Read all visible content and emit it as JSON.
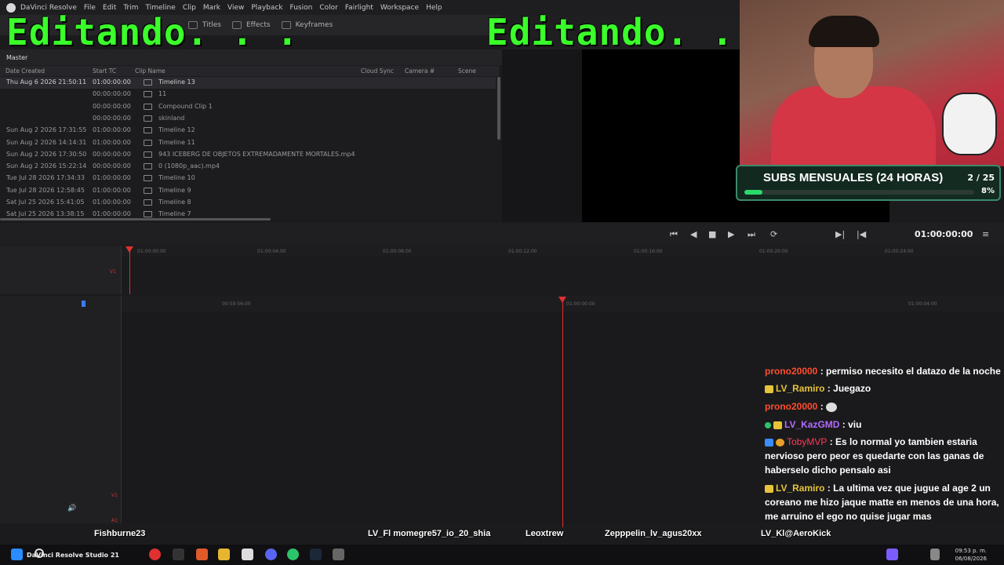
{
  "menubar": {
    "app": "DaVinci Resolve",
    "items": [
      "File",
      "Edit",
      "Trim",
      "Timeline",
      "Clip",
      "Mark",
      "View",
      "Playback",
      "Fusion",
      "Color",
      "Fairlight",
      "Workspace",
      "Help"
    ]
  },
  "toolbar": {
    "titles": "Titles",
    "effects": "Effects",
    "keyframes": "Keyframes"
  },
  "overlay": {
    "left_text": "Editando. . .",
    "right_text": "Editando. . ."
  },
  "mediapool": {
    "bin": "Master",
    "columns": [
      "Date Created",
      "Start TC",
      "Clip Name",
      "Cloud Sync",
      "Camera #",
      "Scene"
    ],
    "rows": [
      {
        "date": "Thu Aug 6 2026 21:50:11",
        "tc": "01:00:00:00",
        "name": "Timeline 13"
      },
      {
        "date": "",
        "tc": "00:00:00:00",
        "name": "11"
      },
      {
        "date": "",
        "tc": "00:00:00:00",
        "name": "Compound Clip 1"
      },
      {
        "date": "",
        "tc": "00:00:00:00",
        "name": "skinland"
      },
      {
        "date": "Sun Aug 2 2026 17:31:55",
        "tc": "01:00:00:00",
        "name": "Timeline 12"
      },
      {
        "date": "Sun Aug 2 2026 14:14:31",
        "tc": "01:00:00:00",
        "name": "Timeline 11"
      },
      {
        "date": "Sun Aug 2 2026 17:30:50",
        "tc": "00:00:00:00",
        "name": "943 ICEBERG DE OBJETOS EXTREMADAMENTE MORTALES.mp4"
      },
      {
        "date": "Sun Aug 2 2026 15:22:14",
        "tc": "00:00:00:00",
        "name": "0 (1080p_aac).mp4"
      },
      {
        "date": "Tue Jul 28 2026 17:34:33",
        "tc": "01:00:00:00",
        "name": "Timeline 10"
      },
      {
        "date": "Tue Jul 28 2026 12:58:45",
        "tc": "01:00:00:00",
        "name": "Timeline 9"
      },
      {
        "date": "Sat Jul 25 2026 15:41:05",
        "tc": "01:00:00:00",
        "name": "Timeline 8"
      },
      {
        "date": "Sat Jul 25 2026 13:38:15",
        "tc": "01:00:00:00",
        "name": "Timeline 7"
      }
    ]
  },
  "viewer": {
    "timecode": "01:00:00:00"
  },
  "timeline": {
    "ruler1": [
      "01:00:00:00",
      "01:00:04:00",
      "01:00:08:00",
      "01:00:12:00",
      "01:00:16:00",
      "01:00:20:00",
      "01:00:24:00"
    ],
    "ruler2": [
      "00:59:56:00",
      "01:00:00:00",
      "01:00:04:00"
    ],
    "track_labels": {
      "v1": "V1",
      "v1b": "V1",
      "a1": "A1"
    }
  },
  "subs_goal": {
    "title": "SUBS MENSUALES (24 HORAS)",
    "count": "2 / 25",
    "percent": "8%",
    "progress": 0.08
  },
  "chat": [
    {
      "user": "prono20000",
      "text": "permiso necesito el datazo de la noche",
      "color": "#ff4d2e"
    },
    {
      "user": "LV_Ramiro",
      "text": "Juegazo",
      "color": "#e6c43a"
    },
    {
      "user": "prono20000",
      "text": "",
      "color": "#ff4d2e"
    },
    {
      "user": "LV_KazGMD",
      "text": "viu",
      "color": "#b36bff"
    },
    {
      "user": "TobyMVP",
      "text": "Es lo normal yo tambien estaria nervioso pero peor es quedarte con las ganas de haberselo dicho pensalo asi",
      "color": "#ff3a5a"
    },
    {
      "user": "LV_Ramiro",
      "text": "La ultima vez que jugue al age 2 un coreano me hizo jaque matte en menos de una hora, me arruino el ego no quise jugar mas",
      "color": "#e6c43a"
    }
  ],
  "bottom_names": [
    "Fishburne23",
    "LV_Fl momegre57_io_20_shia",
    "Leoxtrew",
    "Zepppelin_lv_agus20xx",
    "LV_Kl@AeroKick"
  ],
  "taskbar": {
    "app_label": "DaVinci Resolve Studio 21",
    "time": "09:53 p. m.",
    "date": "06/08/2026"
  }
}
